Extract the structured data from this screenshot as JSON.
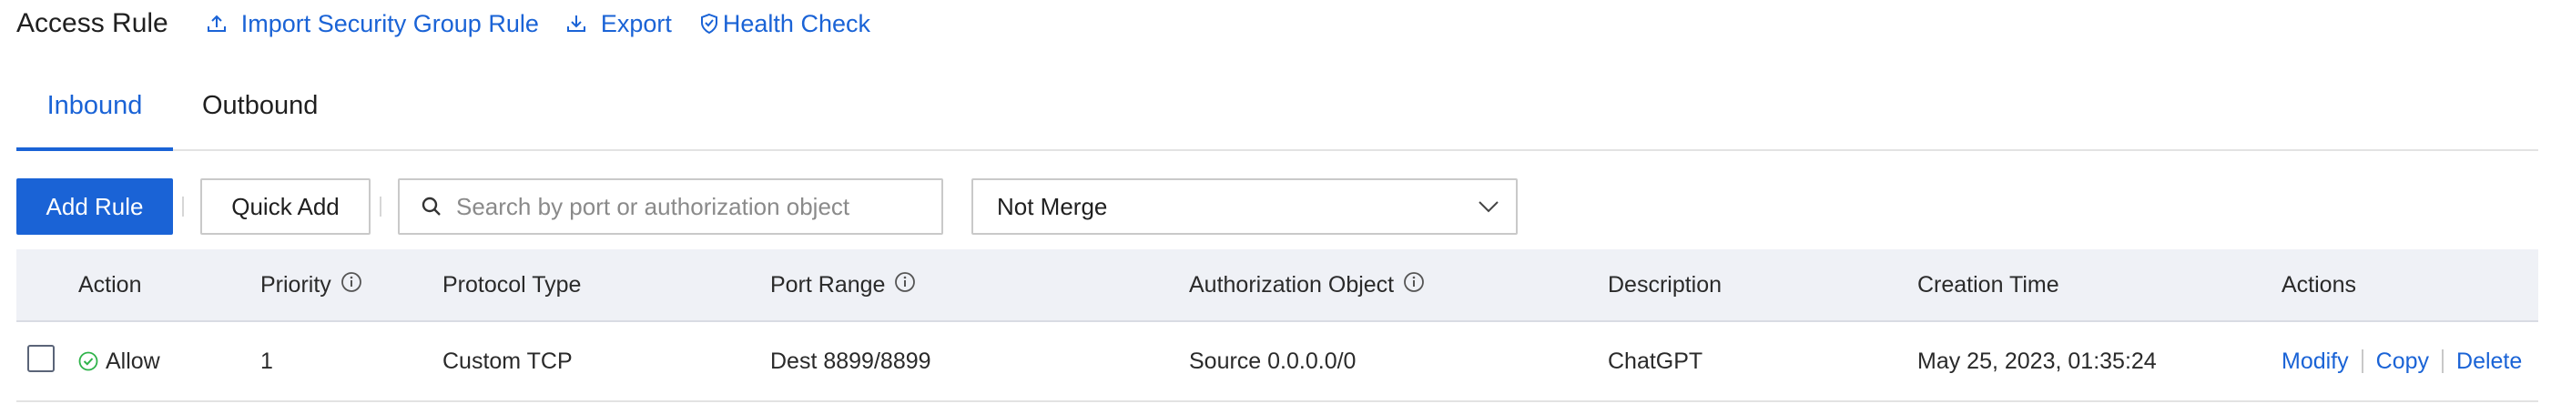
{
  "header": {
    "title": "Access Rule",
    "import_label": "Import Security Group Rule",
    "export_label": "Export",
    "health_label": "Health Check"
  },
  "tabs": [
    {
      "label": "Inbound",
      "active": true
    },
    {
      "label": "Outbound",
      "active": false
    }
  ],
  "toolbar": {
    "add_rule": "Add Rule",
    "quick_add": "Quick Add",
    "search_placeholder": "Search by port or authorization object",
    "merge_value": "Not Merge"
  },
  "table": {
    "columns": [
      "Action",
      "Priority",
      "Protocol Type",
      "Port Range",
      "Authorization Object",
      "Description",
      "Creation Time",
      "Actions"
    ],
    "rows": [
      {
        "action": "Allow",
        "priority": "1",
        "protocol": "Custom TCP",
        "port_range": "Dest 8899/8899",
        "auth_object": "Source 0.0.0.0/0",
        "description": "ChatGPT",
        "created": "May 25, 2023, 01:35:24",
        "ops": [
          "Modify",
          "Copy",
          "Delete"
        ]
      }
    ]
  },
  "colors": {
    "accent": "#1a63d6",
    "allow": "#2fb34a",
    "header_bg": "#eff1f6"
  },
  "icons": {
    "import": "upload-icon",
    "export": "download-icon",
    "health": "shield-check-icon",
    "search": "search-icon",
    "select": "chevron-down-icon",
    "info": "info-icon",
    "allow": "check-circle-icon"
  }
}
